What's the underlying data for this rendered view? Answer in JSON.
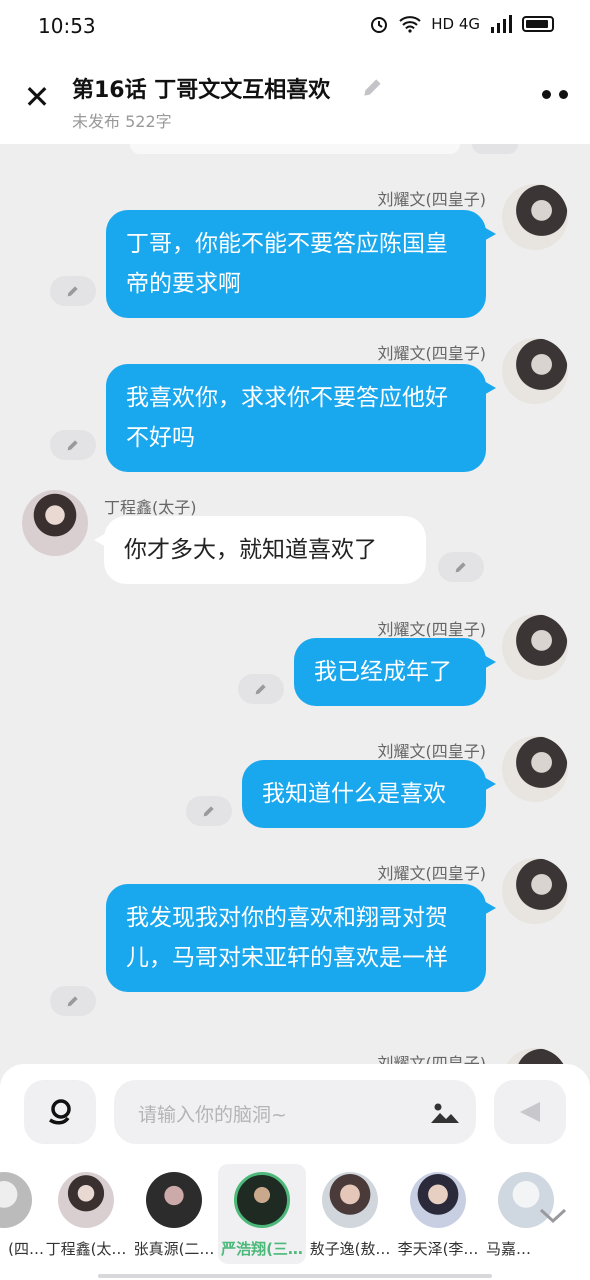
{
  "status": {
    "time": "10:53",
    "network": "HD 4G"
  },
  "header": {
    "title": "第16话   丁哥文文互相喜欢",
    "subtitle": "未发布 522字"
  },
  "messages": [
    {
      "sender": "刘耀文(四皇子)",
      "side": "right",
      "text": "丁哥，你能不能不要答应陈国皇帝的要求啊"
    },
    {
      "sender": "刘耀文(四皇子)",
      "side": "right",
      "text": "我喜欢你，求求你不要答应他好不好吗"
    },
    {
      "sender": "丁程鑫(太子)",
      "side": "left",
      "text": "你才多大，就知道喜欢了"
    },
    {
      "sender": "刘耀文(四皇子)",
      "side": "right",
      "text": "我已经成年了"
    },
    {
      "sender": "刘耀文(四皇子)",
      "side": "right",
      "text": "我知道什么是喜欢"
    },
    {
      "sender": "刘耀文(四皇子)",
      "side": "right",
      "text": "我发现我对你的喜欢和翔哥对贺儿，马哥对宋亚轩的喜欢是一样"
    },
    {
      "sender": "刘耀文(四皇子)",
      "side": "right",
      "text": ""
    }
  ],
  "input": {
    "placeholder": "请输入你的脑洞~"
  },
  "characters": [
    {
      "label": "(四…",
      "selected": false
    },
    {
      "label": "丁程鑫(太…",
      "selected": false
    },
    {
      "label": "张真源(二…",
      "selected": false
    },
    {
      "label": "严浩翔(三…",
      "selected": true
    },
    {
      "label": "敖子逸(敖…",
      "selected": false
    },
    {
      "label": "李天泽(李…",
      "selected": false
    },
    {
      "label": "马嘉…",
      "selected": false
    }
  ]
}
